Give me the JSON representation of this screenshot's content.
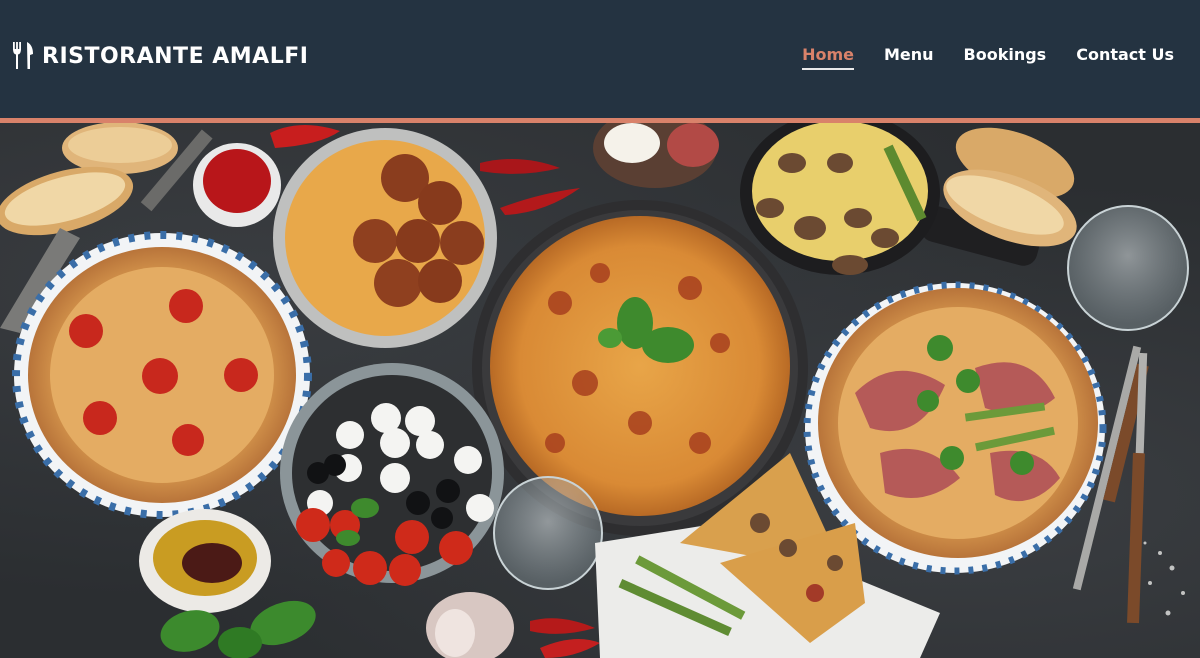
{
  "brand": {
    "name": "RISTORANTE AMALFI",
    "logo_icon": "fork-knife-icon"
  },
  "nav": {
    "items": [
      {
        "label": "Home",
        "active": true
      },
      {
        "label": "Menu",
        "active": false
      },
      {
        "label": "Bookings",
        "active": false
      },
      {
        "label": "Contact Us",
        "active": false
      }
    ]
  },
  "colors": {
    "header_bg": "#243341",
    "accent": "#d9826a",
    "text": "#ffffff"
  },
  "hero": {
    "image": "italian-food-spread"
  }
}
